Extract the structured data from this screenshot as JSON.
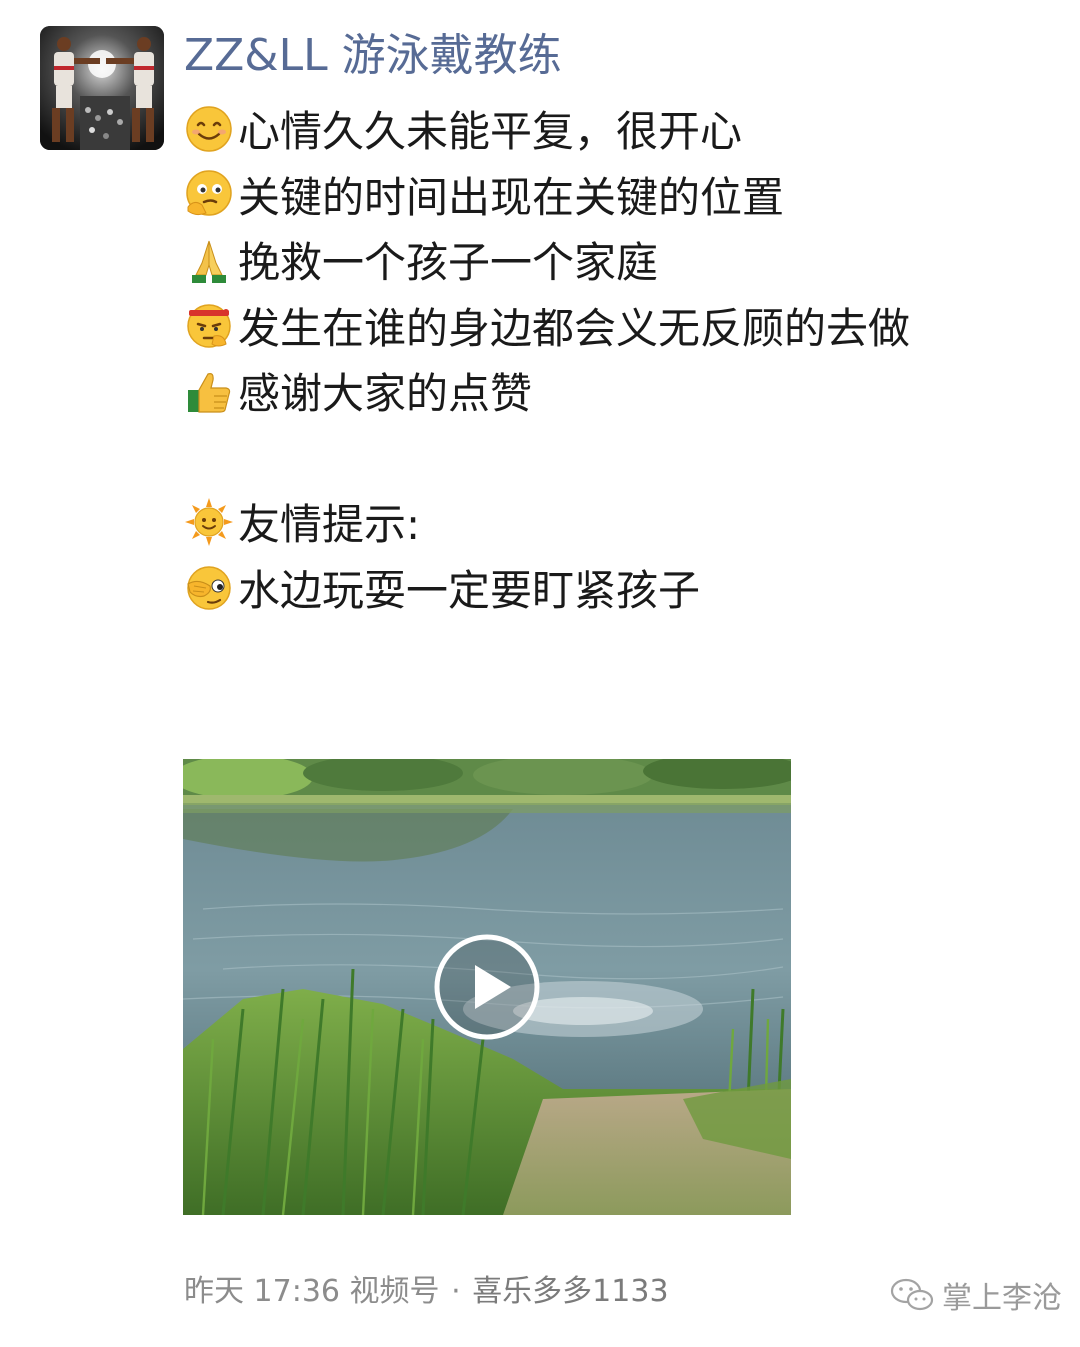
{
  "post": {
    "author_name": "ZZ&LL 游泳戴教练",
    "lines": [
      {
        "emoji": "smile-emoji",
        "text": "心情久久未能平复，很开心"
      },
      {
        "emoji": "thinking-emoji",
        "text": "关键的时间出现在关键的位置"
      },
      {
        "emoji": "pray-emoji",
        "text": "挽救一个孩子一个家庭"
      },
      {
        "emoji": "determined-emoji",
        "text": "发生在谁的身边都会义无反顾的去做"
      },
      {
        "emoji": "thumbs-up-emoji",
        "text": "感谢大家的点赞"
      },
      {
        "emoji": "",
        "text": ""
      },
      {
        "emoji": "sun-emoji",
        "text": "友情提示:"
      },
      {
        "emoji": "peek-emoji",
        "text": "水边玩耍一定要盯紧孩子"
      }
    ],
    "video": {
      "thumbnail": "pond-with-reeds",
      "play_icon": "play-icon"
    },
    "footer": {
      "time": "昨天 17:36",
      "source": "视频号",
      "separator": "·",
      "channel": "喜乐多多1133"
    }
  },
  "watermark": {
    "icon": "wechat-icon",
    "text": "掌上李沧"
  },
  "colors": {
    "author_name": "#576b95",
    "body_text": "#1a1a1a",
    "footer_text": "#8c8c8c"
  }
}
